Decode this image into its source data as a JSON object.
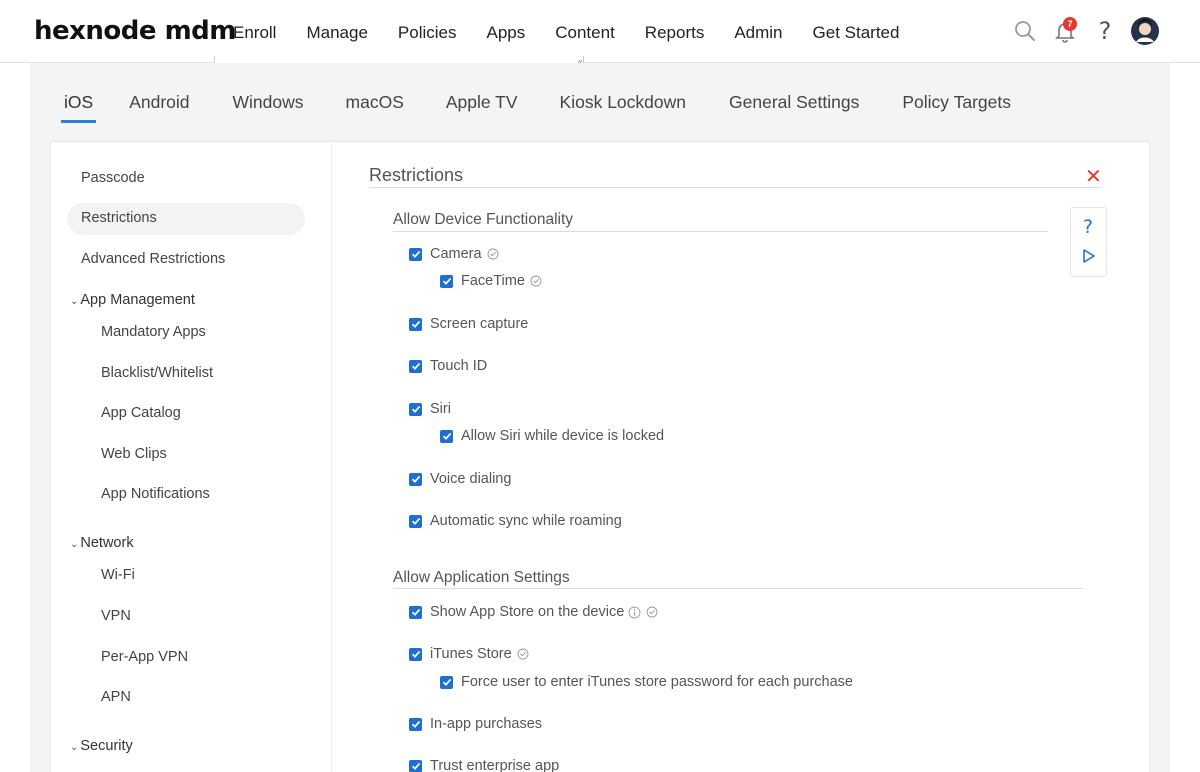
{
  "brand": {
    "logo": "hexnode mdm"
  },
  "nav": {
    "items": [
      {
        "label": "Enroll"
      },
      {
        "label": "Manage"
      },
      {
        "label": "Policies",
        "active": true
      },
      {
        "label": "Apps"
      },
      {
        "label": "Content"
      },
      {
        "label": "Reports"
      },
      {
        "label": "Admin"
      },
      {
        "label": "Get Started"
      }
    ],
    "notification_count": "7",
    "help_label": "?"
  },
  "os_tabs": [
    {
      "label": "iOS",
      "active": true
    },
    {
      "label": "Android"
    },
    {
      "label": "Windows"
    },
    {
      "label": "macOS"
    },
    {
      "label": "Apple TV"
    },
    {
      "label": "Kiosk Lockdown"
    },
    {
      "label": "General Settings"
    },
    {
      "label": "Policy Targets"
    }
  ],
  "sidebar": {
    "items": [
      {
        "label": "Passcode"
      },
      {
        "label": "Restrictions",
        "selected": true
      },
      {
        "label": "Advanced Restrictions"
      }
    ],
    "app_management": {
      "label": "App Management",
      "children": [
        "Mandatory Apps",
        "Blacklist/Whitelist",
        "App Catalog",
        "Web Clips",
        "App Notifications"
      ]
    },
    "network": {
      "label": "Network",
      "children": [
        "Wi-Fi",
        "VPN",
        "Per-App VPN",
        "APN"
      ]
    },
    "security": {
      "label": "Security"
    }
  },
  "content": {
    "title": "Restrictions",
    "close_label": "✕",
    "sections": [
      {
        "title": "Allow Device Functionality",
        "options": [
          {
            "label": "Camera",
            "checked": true,
            "verified": true
          },
          {
            "label": "FaceTime",
            "checked": true,
            "verified": true,
            "child": true
          },
          {
            "label": "Screen capture",
            "checked": true
          },
          {
            "label": "Touch ID",
            "checked": true
          },
          {
            "label": "Siri",
            "checked": true
          },
          {
            "label": "Allow Siri while device is locked",
            "checked": true,
            "child": true
          },
          {
            "label": "Voice dialing",
            "checked": true
          },
          {
            "label": "Automatic sync while roaming",
            "checked": true
          }
        ]
      },
      {
        "title": "Allow Application Settings",
        "options": [
          {
            "label": "Show App Store on the device",
            "checked": true,
            "info": true,
            "verified": true
          },
          {
            "label": "iTunes Store",
            "checked": true,
            "verified": true
          },
          {
            "label": "Force user to enter iTunes store password for each purchase",
            "checked": true,
            "child": true
          },
          {
            "label": "In-app purchases",
            "checked": true
          },
          {
            "label": "Trust enterprise app",
            "checked": true
          }
        ]
      }
    ]
  },
  "help_panel": {
    "question_label": "?"
  },
  "colors": {
    "accent": "#2f7de1",
    "checkbox": "#1f6fd1",
    "close": "#e03b32",
    "badge": "#e23a2e"
  }
}
